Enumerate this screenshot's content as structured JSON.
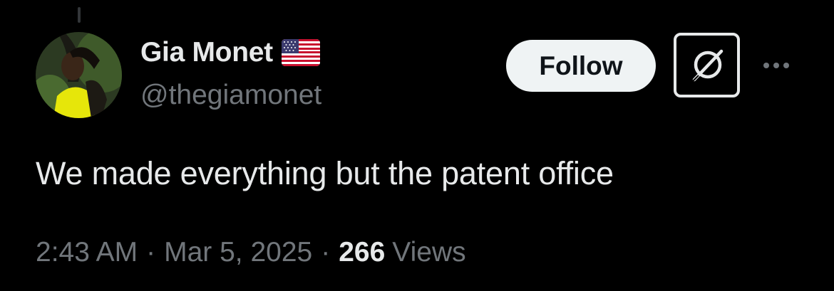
{
  "author": {
    "display_name": "Gia Monet",
    "handle": "@thegiamonet",
    "flag_icon": "us-flag-icon"
  },
  "actions": {
    "follow_label": "Follow",
    "grok_icon": "grok-icon",
    "more_icon": "more-horizontal-icon"
  },
  "tweet": {
    "text": "We made everything but the patent office"
  },
  "meta": {
    "time": "2:43 AM",
    "separator": "·",
    "date": "Mar 5, 2025",
    "views_count": "266",
    "views_label": "Views"
  },
  "colors": {
    "background": "#000000",
    "primary_text": "#e7e9ea",
    "secondary_text": "#71767b",
    "follow_bg": "#eff3f4",
    "follow_text": "#0f1419"
  }
}
